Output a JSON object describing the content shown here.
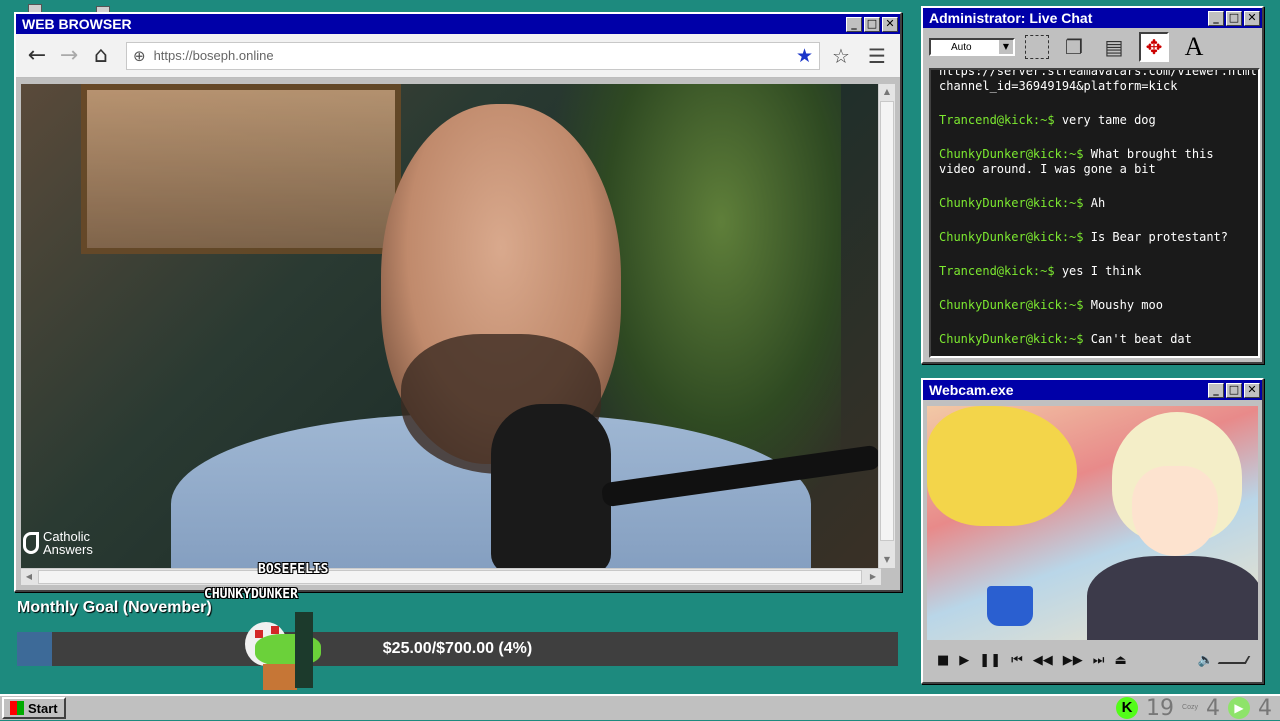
{
  "browser": {
    "title": "WEB BROWSER",
    "url": "https://boseph.online",
    "back_icon": "←",
    "forward_icon": "→",
    "home_icon": "⌂",
    "globe_icon": "⊕",
    "bookmark_icon": "★",
    "star_icon": "☆",
    "menu_icon": "☰",
    "video_watermark": "Catholic Answers"
  },
  "chat": {
    "title": "Administrator: Live Chat",
    "zoom": "Auto",
    "header_line": "https://server.streamavatars.com/viewer.html?channel_id=36949194&platform=kick",
    "messages": [
      {
        "user": "Trancend@kick:~$",
        "text": "very tame dog"
      },
      {
        "user": "ChunkyDunker@kick:~$",
        "text": "What brought this video around. I was gone a bit"
      },
      {
        "user": "ChunkyDunker@kick:~$",
        "text": "Ah"
      },
      {
        "user": "ChunkyDunker@kick:~$",
        "text": "Is Bear protestant?"
      },
      {
        "user": "Trancend@kick:~$",
        "text": "yes I think"
      },
      {
        "user": "ChunkyDunker@kick:~$",
        "text": "Moushy moo"
      },
      {
        "user": "ChunkyDunker@kick:~$",
        "text": "Can't beat dat"
      }
    ]
  },
  "webcam": {
    "title": "Webcam.exe",
    "controls": {
      "stop": "■",
      "play": "▶",
      "pause": "❚❚",
      "prev": "⏮",
      "rewind": "◀◀",
      "forward": "▶▶",
      "next": "⏭",
      "eject": "⏏",
      "volume": "🔈"
    }
  },
  "goal": {
    "label": "Monthly Goal (November)",
    "text": "$25.00/$700.00 (4%)",
    "progress_percent": 4
  },
  "avatars": {
    "name1": "BOSEFELIS",
    "name2": "CHUNKYDUNKER"
  },
  "taskbar": {
    "start_label": "Start",
    "kick_icon": "K",
    "count1": "19",
    "cozy_label": "Cozy",
    "count2": "4",
    "count3": "4",
    "play_icon": "▶"
  },
  "window_buttons": {
    "min": "_",
    "max": "□",
    "close": "✕"
  },
  "colors": {
    "titlebar": "#0000a8",
    "desktop": "#1d8a7e",
    "chat_user": "#7ce830",
    "goal_fill": "#3d6a98",
    "kick": "#53fc18"
  }
}
